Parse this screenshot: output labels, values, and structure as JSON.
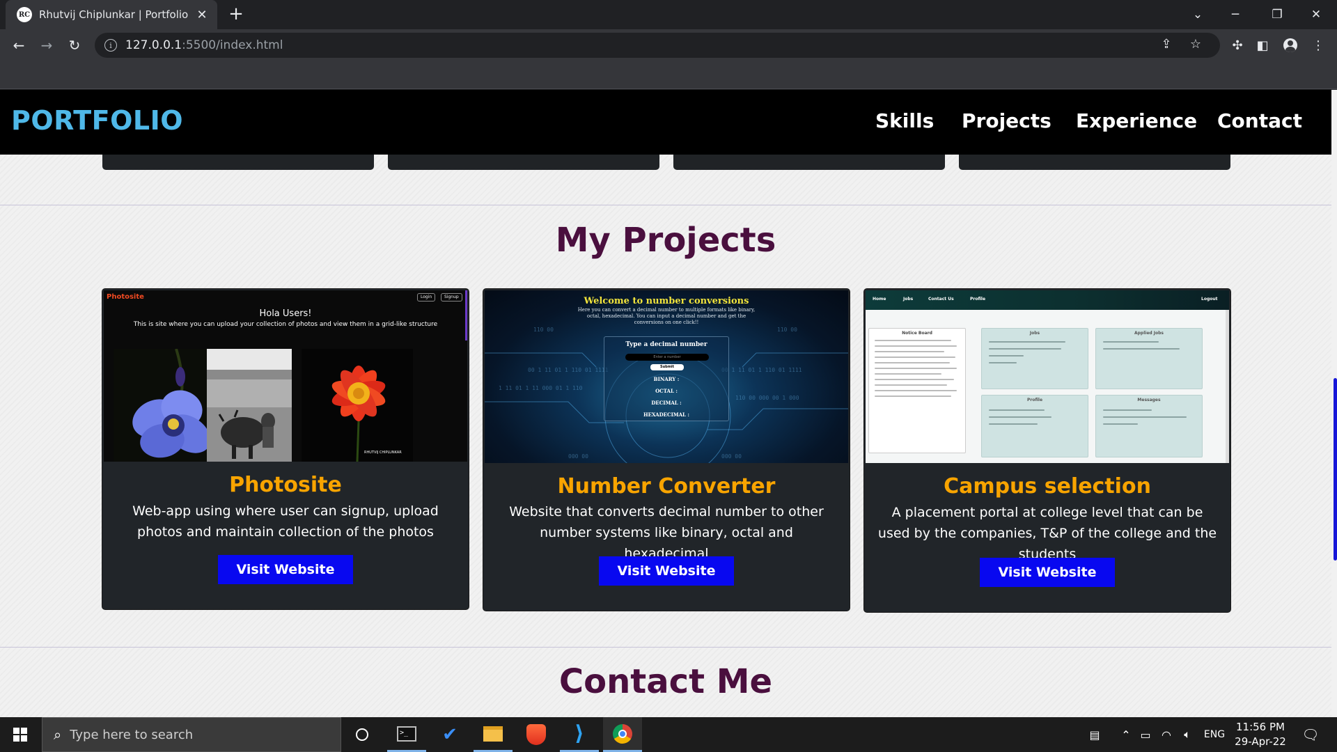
{
  "browser": {
    "tab_title": "Rhutvij Chiplunkar | Portfolio",
    "tab_favicon_text": "RC",
    "url_host": "127.0.0.1",
    "url_path": ":5500/index.html"
  },
  "site": {
    "logo": "PORTFOLIO",
    "nav": [
      "Skills",
      "Projects",
      "Experience",
      "Contact"
    ],
    "projects_heading": "My Projects",
    "contact_heading": "Contact Me",
    "projects": [
      {
        "title": "Photosite",
        "description": "Web-app using where user can signup, upload photos and maintain collection of the photos",
        "button": "Visit Website",
        "preview": {
          "brand": "Photosite",
          "login": "Login",
          "signup": "Signup",
          "heading": "Hola Users!",
          "subheading": "This is site where you can upload your collection of photos and view them in a grid-like structure",
          "watermark": "RHUTVIJ CHIPLUNKAR"
        }
      },
      {
        "title": "Number Converter",
        "description": "Website that converts decimal number to other number systems like binary, octal and hexadecimal",
        "button": "Visit Website",
        "preview": {
          "heading": "Welcome to number conversions",
          "intro": "Here you can convert a decimal number to multiple formats like binary, octal, hexadecimal. You can input a decimal number and get the conversions on one click!!",
          "prompt": "Type a decimal number",
          "placeholder": "Enter a number",
          "submit": "Submit",
          "binary": "BINARY :",
          "octal": "OCTAL :",
          "decimal": "DECIMAL :",
          "hexadecimal": "HEXADECIMAL :"
        }
      },
      {
        "title": "Campus selection",
        "description": "A placement portal at college level that can be used by the companies, T&P of the college and the students",
        "button": "Visit Website",
        "preview": {
          "nav": [
            "Home",
            "Jobs",
            "Contact Us",
            "Profile"
          ],
          "logout": "Logout",
          "notice_board": "Notice Board",
          "jobs": "Jobs",
          "applied_jobs": "Applied Jobs",
          "profile": "Profile",
          "messages": "Messages"
        }
      }
    ]
  },
  "taskbar": {
    "search_placeholder": "Type here to search",
    "language": "ENG",
    "time": "11:56 PM",
    "date": "29-Apr-22"
  },
  "colors": {
    "logo": "#4fb8e8",
    "heading": "#4a0f3e",
    "project_title": "#f8a400",
    "button": "#0808f0",
    "card": "#212529"
  }
}
